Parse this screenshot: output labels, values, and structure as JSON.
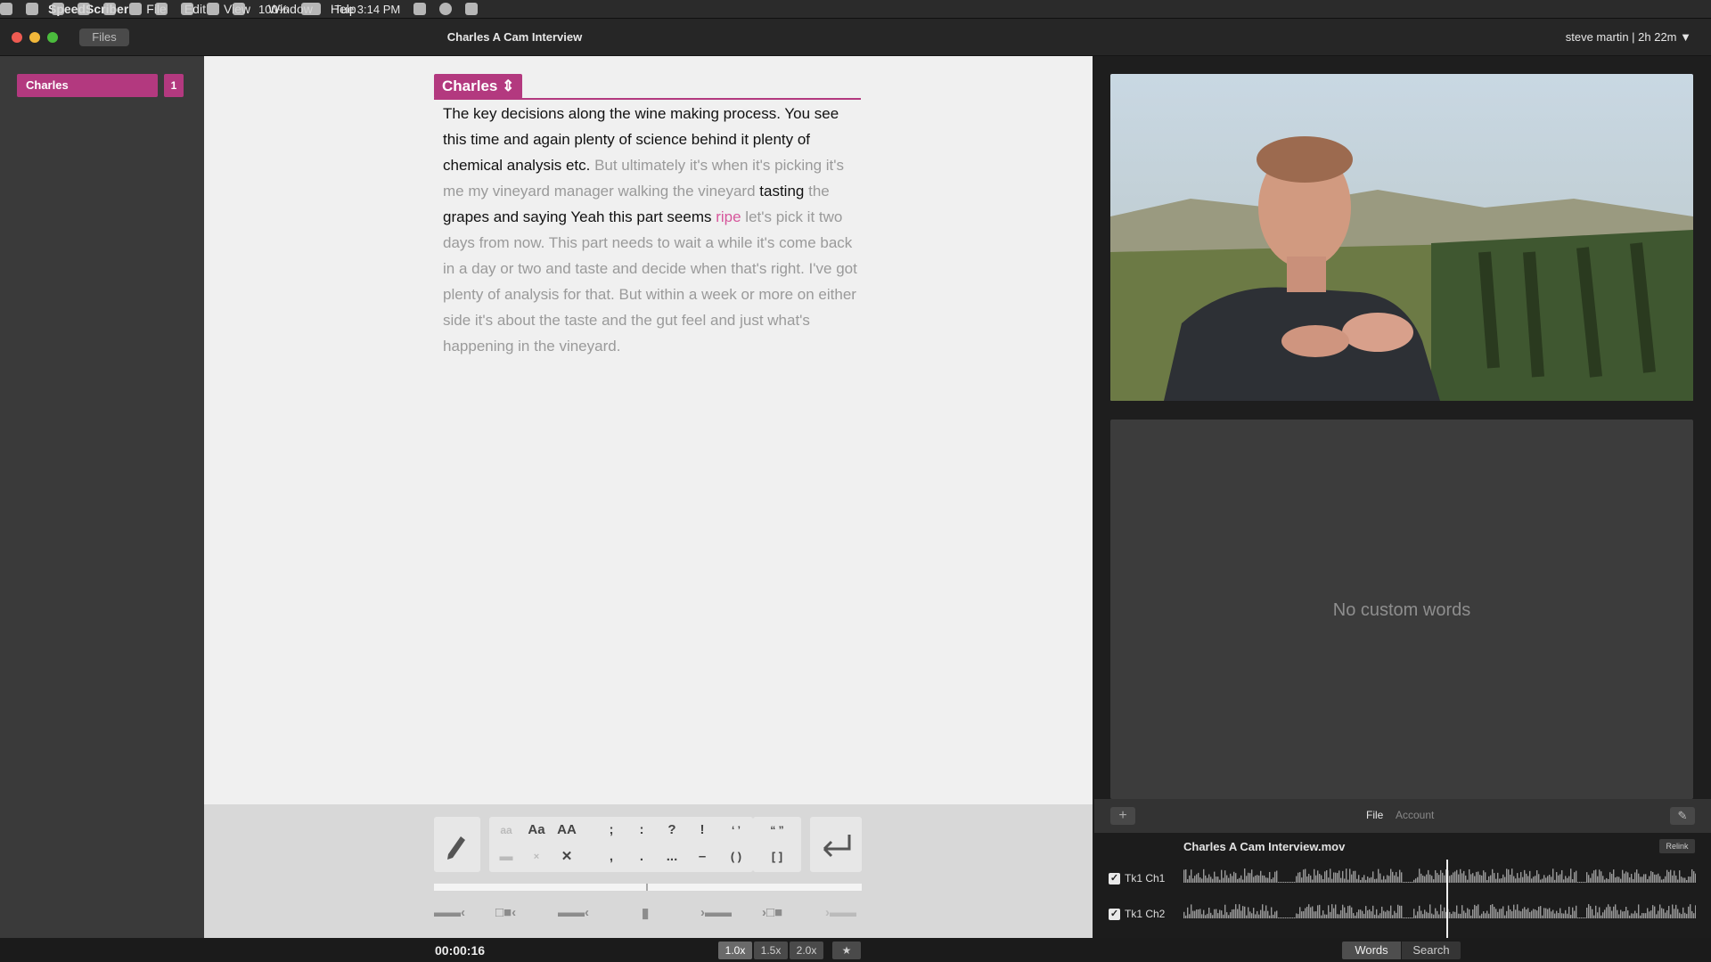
{
  "menubar": {
    "app_name": "SpeedScriber",
    "menus": [
      "File",
      "Edit",
      "View",
      "Window",
      "Help"
    ],
    "battery": "100%",
    "clock": "Tue 3:14 PM"
  },
  "window": {
    "files_button": "Files",
    "title": "Charles A Cam Interview",
    "user_info": "steve martin | 2h 22m ▼"
  },
  "sidebar": {
    "speaker_name": "Charles",
    "speaker_count": "1"
  },
  "editor": {
    "speaker_tag": "Charles ⇕",
    "segments": [
      {
        "text": "The key decisions along the wine making process. You see this time and again plenty of science behind it plenty of chemical analysis etc.",
        "style": "b"
      },
      {
        "text": " But ultimately it's when it's picking it's me my vineyard manager walking the vineyard ",
        "style": "g"
      },
      {
        "text": "tasting",
        "style": "b"
      },
      {
        "text": " the ",
        "style": "g"
      },
      {
        "text": "grapes and saying Yeah this part seems",
        "style": "b"
      },
      {
        "text": " ",
        "style": "g"
      },
      {
        "text": "ripe",
        "style": "p"
      },
      {
        "text": " let's pick it two days from now. This part needs to wait a while it's come back in a day or two and taste and decide when that's right. I've got plenty of analysis for that. But within a week or more on either side it's about the taste and the gut feel and just what's happening in the vineyard.",
        "style": "g"
      }
    ]
  },
  "toolbar": {
    "case_lower": "aa",
    "case_title": "Aa",
    "case_upper": "AA",
    "punct_semicolon": ";",
    "punct_colon": ":",
    "punct_question": "?",
    "punct_exclaim": "!",
    "punct_single_quotes": "‘ ’",
    "punct_double_quotes": "“ ”",
    "punct_comma": ",",
    "punct_period": ".",
    "punct_ellipsis": "...",
    "punct_dash": "–",
    "punct_parens": "( )",
    "punct_brackets": "[ ]",
    "delete_mark": "✕",
    "progress": 0.5
  },
  "bottombar": {
    "timecode": "00:00:16",
    "speeds": [
      "1.0x",
      "1.5x",
      "2.0x"
    ],
    "star": "★",
    "tabs": [
      "Words",
      "Search"
    ]
  },
  "right_panel": {
    "empty_message": "No custom words",
    "tabs": [
      "File",
      "Account"
    ],
    "add_label": "+",
    "edit_label": "✎"
  },
  "media": {
    "filename": "Charles A Cam Interview.mov",
    "relink": "Relink",
    "tracks": [
      "Tk1 Ch1",
      "Tk1 Ch2"
    ]
  },
  "colors": {
    "accent": "#b3397f",
    "highlight_word": "#d6569b"
  }
}
